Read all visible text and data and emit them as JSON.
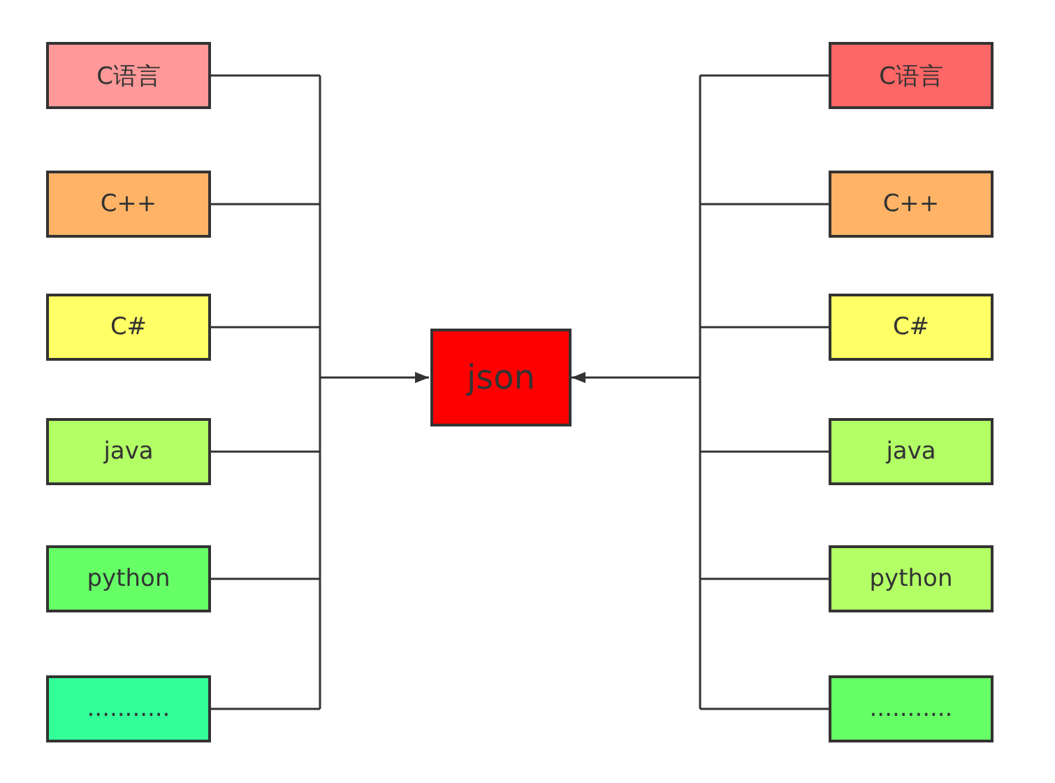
{
  "left_nodes": [
    {
      "label": "C语言",
      "color": "#ff9999"
    },
    {
      "label": "C++",
      "color": "#ffb366"
    },
    {
      "label": "C#",
      "color": "#ffff66"
    },
    {
      "label": "java",
      "color": "#b3ff66"
    },
    {
      "label": "python",
      "color": "#66ff66"
    },
    {
      "label": "...........",
      "color": "#33ff99"
    }
  ],
  "center_node": {
    "label": "json",
    "color": "#ff0000"
  },
  "right_nodes": [
    {
      "label": "C语言",
      "color": "#ff6666"
    },
    {
      "label": "C++",
      "color": "#ffb366"
    },
    {
      "label": "C#",
      "color": "#ffff66"
    },
    {
      "label": "java",
      "color": "#b3ff66"
    },
    {
      "label": "python",
      "color": "#b3ff66"
    },
    {
      "label": "...........",
      "color": "#66ff66"
    }
  ]
}
